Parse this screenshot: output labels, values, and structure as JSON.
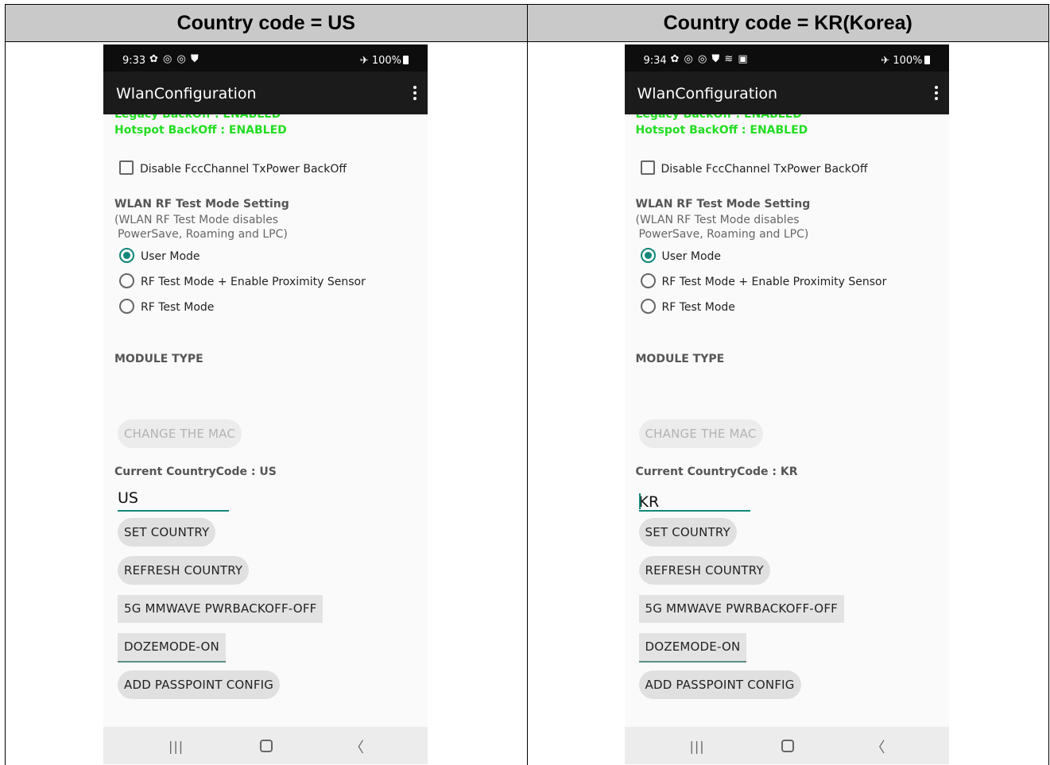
{
  "headers": [
    "Country code = US",
    "Country code = KR(Korea)"
  ],
  "panels": [
    {
      "status": {
        "time": "9:33",
        "icons": "✿ ◎ ◎ ⛊",
        "battery": "✈ 100%"
      },
      "app_title": "WlanConfiguration",
      "legacy_backoff": "Legacy BackOff : ENABLED",
      "hotspot_backoff": "Hotspot BackOff : ENABLED",
      "checkbox_label": "Disable FccChannel TxPower BackOff",
      "rf_title": "WLAN RF Test Mode Setting",
      "rf_desc1": "(WLAN RF Test Mode disables",
      "rf_desc2": "PowerSave, Roaming and LPC)",
      "radio_user": "User Mode",
      "radio_rf_prox": "RF Test Mode + Enable Proximity Sensor",
      "radio_rf": "RF Test Mode",
      "module_type": "MODULE TYPE",
      "btn_change_mac": "CHANGE THE MAC",
      "cc_label": "Current CountryCode : US",
      "cc_value": "US",
      "btn_set": "SET COUNTRY",
      "btn_refresh": "REFRESH COUNTRY",
      "btn_mmwave": "5G MMWAVE PWRBACKOFF-OFF",
      "btn_doze": "DOZEMODE-ON",
      "btn_passpoint": "ADD PASSPOINT CONFIG",
      "nav": {
        "recents": "|||",
        "back": "〈"
      }
    },
    {
      "status": {
        "time": "9:34",
        "icons": "✿ ◎ ◎ ⛊ ≋ ▣",
        "battery": "✈ 100%"
      },
      "app_title": "WlanConfiguration",
      "legacy_backoff": "Legacy BackOff : ENABLED",
      "hotspot_backoff": "Hotspot BackOff : ENABLED",
      "checkbox_label": "Disable FccChannel TxPower BackOff",
      "rf_title": "WLAN RF Test Mode Setting",
      "rf_desc1": "(WLAN RF Test Mode disables",
      "rf_desc2": "PowerSave, Roaming and LPC)",
      "radio_user": "User Mode",
      "radio_rf_prox": "RF Test Mode + Enable Proximity Sensor",
      "radio_rf": "RF Test Mode",
      "module_type": "MODULE TYPE",
      "btn_change_mac": "CHANGE THE MAC",
      "cc_label": "Current CountryCode : KR",
      "cc_value": "KR",
      "btn_set": "SET COUNTRY",
      "btn_refresh": "REFRESH COUNTRY",
      "btn_mmwave": "5G MMWAVE PWRBACKOFF-OFF",
      "btn_doze": "DOZEMODE-ON",
      "btn_passpoint": "ADD PASSPOINT CONFIG",
      "nav": {
        "recents": "|||",
        "back": "〈"
      }
    }
  ]
}
